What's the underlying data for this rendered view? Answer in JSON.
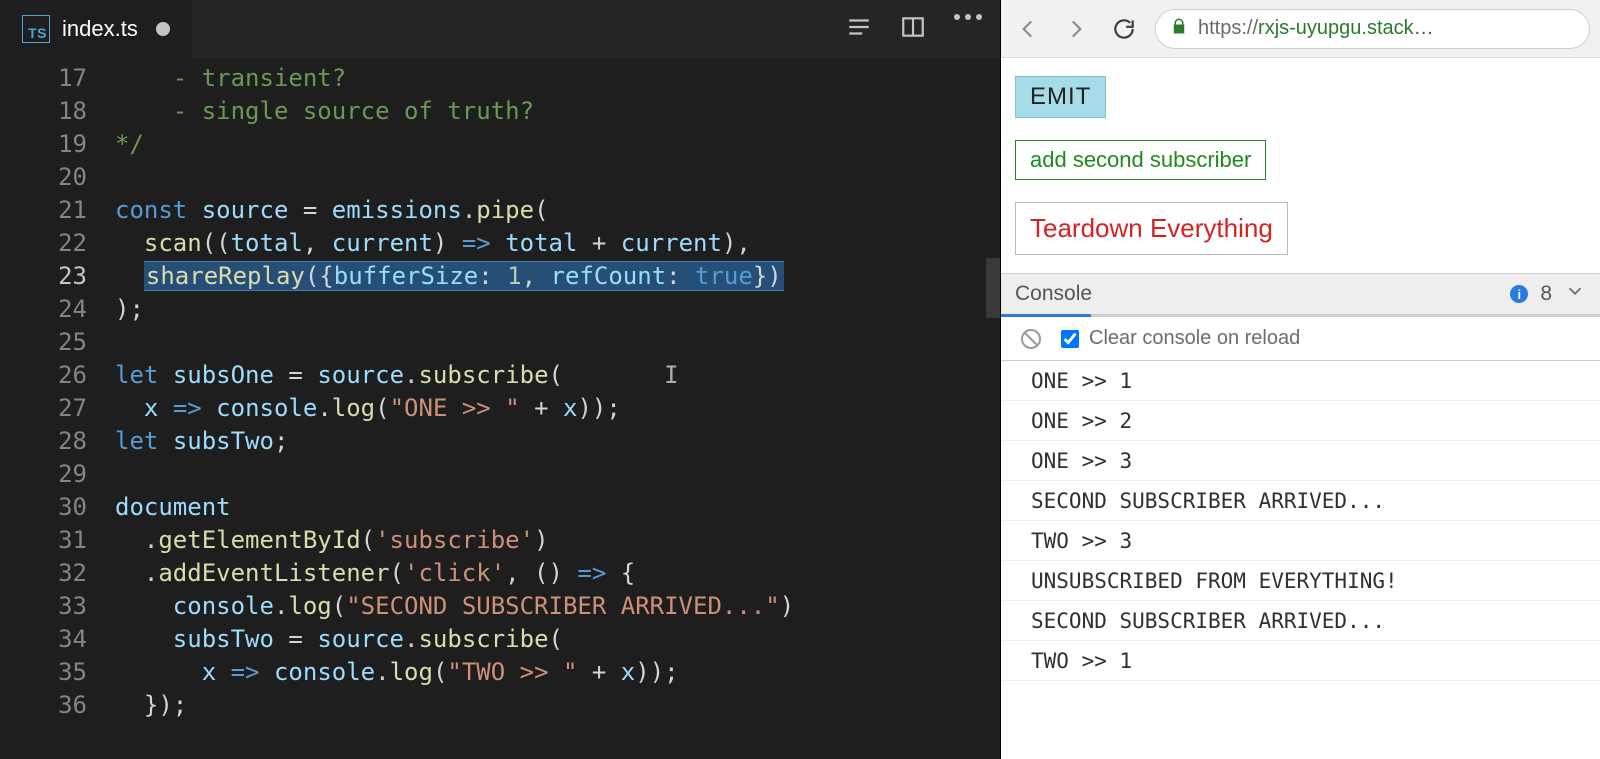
{
  "editor": {
    "filename": "index.ts",
    "fileicon_text": "TS",
    "dirty": true,
    "line_start": 17,
    "active_line": 23,
    "lines": [
      [
        [
          "c",
          "    - transient?"
        ]
      ],
      [
        [
          "c",
          "    - single source of truth?"
        ]
      ],
      [
        [
          "c",
          "*/"
        ]
      ],
      [
        [
          "n",
          ""
        ]
      ],
      [
        [
          "k",
          "const"
        ],
        [
          "n",
          " "
        ],
        [
          "v",
          "source"
        ],
        [
          "n",
          " = "
        ],
        [
          "v",
          "emissions"
        ],
        [
          "n",
          "."
        ],
        [
          "f",
          "pipe"
        ],
        [
          "n",
          "("
        ]
      ],
      [
        [
          "n",
          "  "
        ],
        [
          "f",
          "scan"
        ],
        [
          "n",
          "(("
        ],
        [
          "v",
          "total"
        ],
        [
          "n",
          ", "
        ],
        [
          "v",
          "current"
        ],
        [
          "n",
          ") "
        ],
        [
          "k",
          "=>"
        ],
        [
          "n",
          " "
        ],
        [
          "v",
          "total"
        ],
        [
          "n",
          " + "
        ],
        [
          "v",
          "current"
        ],
        [
          "n",
          "),"
        ]
      ],
      [
        [
          "n",
          "  "
        ],
        [
          "hl",
          "shareReplay({bufferSize: 1, refCount: true})"
        ]
      ],
      [
        [
          "n",
          ");"
        ]
      ],
      [
        [
          "n",
          ""
        ]
      ],
      [
        [
          "k",
          "let"
        ],
        [
          "n",
          " "
        ],
        [
          "v",
          "subsOne"
        ],
        [
          "n",
          " = "
        ],
        [
          "v",
          "source"
        ],
        [
          "n",
          "."
        ],
        [
          "f",
          "subscribe"
        ],
        [
          "n",
          "("
        ]
      ],
      [
        [
          "n",
          "  "
        ],
        [
          "v",
          "x"
        ],
        [
          "n",
          " "
        ],
        [
          "k",
          "=>"
        ],
        [
          "n",
          " "
        ],
        [
          "v",
          "console"
        ],
        [
          "n",
          "."
        ],
        [
          "f",
          "log"
        ],
        [
          "n",
          "("
        ],
        [
          "s",
          "\"ONE >> \""
        ],
        [
          "n",
          " + "
        ],
        [
          "v",
          "x"
        ],
        [
          "n",
          "));"
        ]
      ],
      [
        [
          "k",
          "let"
        ],
        [
          "n",
          " "
        ],
        [
          "v",
          "subsTwo"
        ],
        [
          "n",
          ";"
        ]
      ],
      [
        [
          "n",
          ""
        ]
      ],
      [
        [
          "v",
          "document"
        ]
      ],
      [
        [
          "n",
          "  ."
        ],
        [
          "f",
          "getElementById"
        ],
        [
          "n",
          "("
        ],
        [
          "s",
          "'subscribe'"
        ],
        [
          "n",
          ")"
        ]
      ],
      [
        [
          "n",
          "  ."
        ],
        [
          "f",
          "addEventListener"
        ],
        [
          "n",
          "("
        ],
        [
          "s",
          "'click'"
        ],
        [
          "n",
          ", () "
        ],
        [
          "k",
          "=>"
        ],
        [
          "n",
          " {"
        ]
      ],
      [
        [
          "n",
          "    "
        ],
        [
          "v",
          "console"
        ],
        [
          "n",
          "."
        ],
        [
          "f",
          "log"
        ],
        [
          "n",
          "("
        ],
        [
          "s",
          "\"SECOND SUBSCRIBER ARRIVED...\""
        ],
        [
          "n",
          ")"
        ]
      ],
      [
        [
          "n",
          "    "
        ],
        [
          "v",
          "subsTwo"
        ],
        [
          "n",
          " = "
        ],
        [
          "v",
          "source"
        ],
        [
          "n",
          "."
        ],
        [
          "f",
          "subscribe"
        ],
        [
          "n",
          "("
        ]
      ],
      [
        [
          "n",
          "      "
        ],
        [
          "v",
          "x"
        ],
        [
          "n",
          " "
        ],
        [
          "k",
          "=>"
        ],
        [
          "n",
          " "
        ],
        [
          "v",
          "console"
        ],
        [
          "n",
          "."
        ],
        [
          "f",
          "log"
        ],
        [
          "n",
          "("
        ],
        [
          "s",
          "\"TWO >> \""
        ],
        [
          "n",
          " + "
        ],
        [
          "v",
          "x"
        ],
        [
          "n",
          "));"
        ]
      ],
      [
        [
          "n",
          "  });"
        ]
      ]
    ]
  },
  "browser": {
    "url_display_host": "rxjs-uyupgu.stack",
    "page_buttons": {
      "emit": "EMIT",
      "add_sub": "add second subscriber",
      "teardown": "Teardown Everything"
    },
    "console": {
      "title": "Console",
      "info_count": "8",
      "clear_label": "Clear console on reload",
      "clear_checked": true,
      "entries": [
        "ONE >> 1",
        "ONE >> 2",
        "ONE >> 3",
        "SECOND SUBSCRIBER ARRIVED...",
        "TWO >> 3",
        "UNSUBSCRIBED FROM EVERYTHING!",
        "SECOND SUBSCRIBER ARRIVED...",
        "TWO >> 1"
      ]
    }
  }
}
